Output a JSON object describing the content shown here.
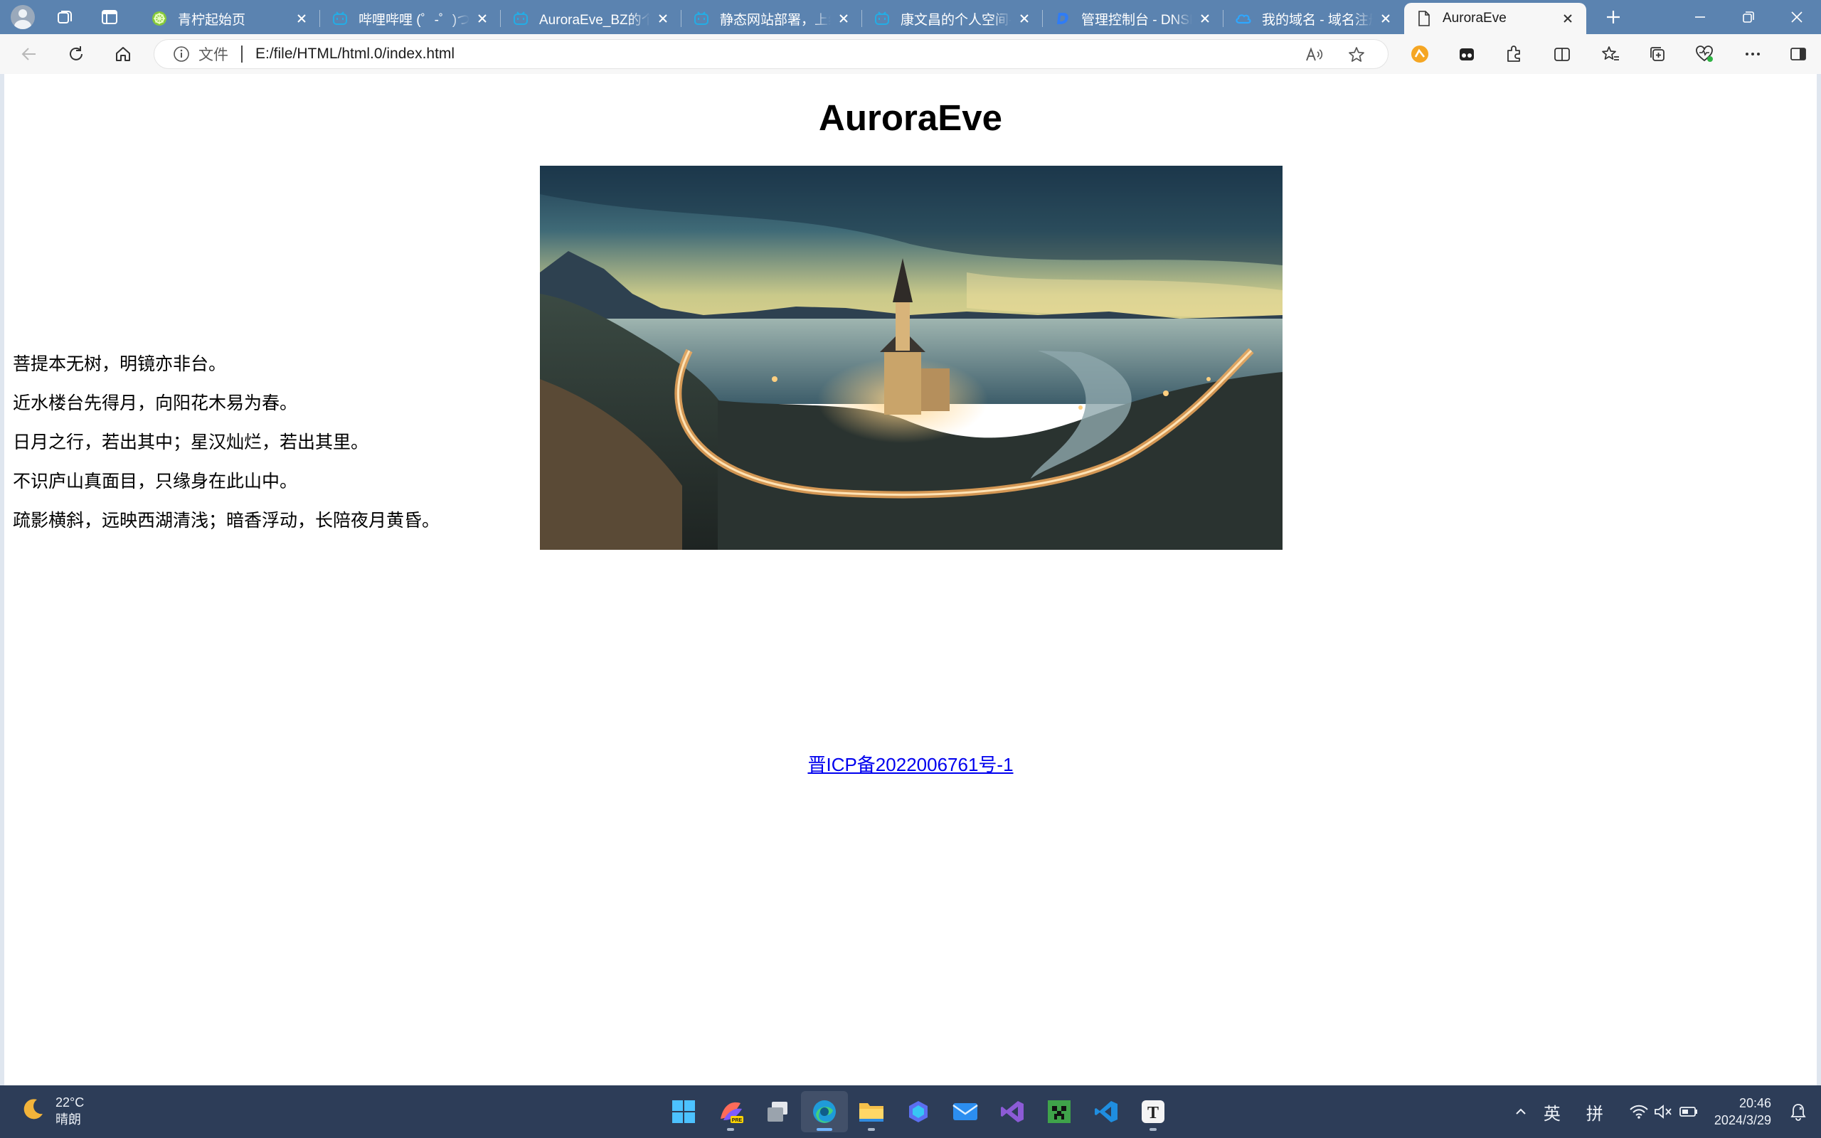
{
  "browser": {
    "tabs": [
      {
        "title": "青柠起始页",
        "favicon": "lemon-start-icon",
        "active": false
      },
      {
        "title": "哔哩哔哩 (゜-゜)つロ 干杯~",
        "favicon": "bilibili-icon",
        "active": false
      },
      {
        "title": "AuroraEve_BZ的个人空间",
        "favicon": "bilibili-icon",
        "active": false
      },
      {
        "title": "静态网站部署，上线",
        "favicon": "bilibili-icon",
        "active": false
      },
      {
        "title": "康文昌的个人空间-哔",
        "favicon": "bilibili-icon",
        "active": false
      },
      {
        "title": "管理控制台 - DNSPod",
        "favicon": "dnspod-icon",
        "active": false
      },
      {
        "title": "我的域名 - 域名注册",
        "favicon": "cloud-icon",
        "active": false
      },
      {
        "title": "AuroraEve",
        "favicon": "page-icon",
        "active": true
      }
    ],
    "address": {
      "scheme_label": "文件",
      "url": "E:/file/HTML/html.0/index.html"
    }
  },
  "page": {
    "heading": "AuroraEve",
    "image_subject": "twilight-church-landscape",
    "lines": [
      "菩提本无树，明镜亦非台。",
      "近水楼台先得月，向阳花木易为春。",
      "日月之行，若出其中；星汉灿烂，若出其里。",
      "不识庐山真面目，只缘身在此山中。",
      "疏影横斜，远映西湖清浅；暗香浮动，长陪夜月黄昏。"
    ],
    "icp_link": "晋ICP备2022006761号-1"
  },
  "taskbar": {
    "weather": {
      "temp": "22°C",
      "condition": "晴朗"
    },
    "apps": [
      "start-icon",
      "figma-pre-icon",
      "file-manager-icon",
      "edge-icon",
      "folder-icon",
      "copilot-icon",
      "mail-icon",
      "visual-studio-icon",
      "minecraft-icon",
      "vscode-icon",
      "typora-icon"
    ],
    "ime_lang": "英",
    "ime_mode": "拼",
    "time": "20:46",
    "date": "2024/3/29"
  }
}
